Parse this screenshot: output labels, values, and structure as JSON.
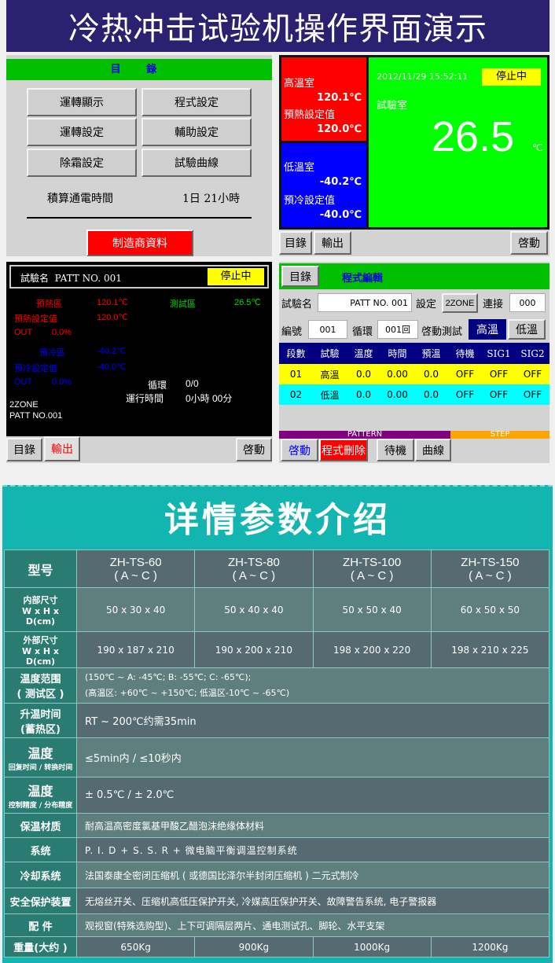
{
  "banner": {
    "title": "冷热冲击试验机操作界面演示"
  },
  "menu_panel": {
    "header": "目 錄",
    "buttons": [
      "運轉顯示",
      "程式設定",
      "運轉設定",
      "輔助設定",
      "除霜設定",
      "試驗曲線"
    ],
    "power_time_label": "積算通電時間",
    "power_time_value": "1日 21小時",
    "manufacturer_button": "制造商資料"
  },
  "monitor_panel": {
    "hot": {
      "label": "高溫室",
      "value": "120.1℃",
      "set_label": "預熱設定值",
      "set_value": "120.0℃"
    },
    "cold": {
      "label": "低溫室",
      "value": "-40.2℃",
      "set_label": "預冷設定值",
      "set_value": "-40.0℃"
    },
    "datetime": "2012/11/29 15:52:11",
    "status": "停止中",
    "test_label": "試驗室",
    "test_value": "26.5",
    "unit": "℃",
    "bottom_buttons": {
      "menu": "目錄",
      "output": "輸出",
      "start": "啓動"
    },
    "colors": {
      "hot": "#ff0000",
      "cold": "#0000ff",
      "test": "#00ff00",
      "status": "#ffff00"
    }
  },
  "run_panel": {
    "test_name_label": "試驗名",
    "test_name": "PATT NO. 001",
    "status": "停止中",
    "preheat_label": "預熱區",
    "preheat_value": "120.1℃",
    "preheat_set_label": "預熱設定值",
    "preheat_set_value": "120.0℃",
    "hot_out_label": "OUT",
    "hot_out_value": "0.0%",
    "test_zone_label": "測試區",
    "test_zone_value": "26.5℃",
    "precool_label": "預冷區",
    "precool_value": "-40.2℃",
    "precool_set_label": "預冷設定值",
    "precool_set_value": "-40.0℃",
    "cold_out_label": "OUT",
    "cold_out_value": "0.0%",
    "cycle_label": "循環",
    "cycle_value": "0/0",
    "runtime_label": "運行時間",
    "runtime_value": "0小時 00分",
    "zone_mode": "2ZONE",
    "pattern_name": "PATT NO.001",
    "bottom_buttons": {
      "menu": "目錄",
      "output": "輸出",
      "start": "啓動"
    }
  },
  "program_panel": {
    "menu_button": "目錄",
    "title": "程式編輯",
    "test_name_label": "試驗名",
    "test_name_value": "PATT NO. 001",
    "setting_label": "設定",
    "setting_value": "2ZONE",
    "link_label": "連接",
    "link_value": "000",
    "number_label": "編號",
    "number_value": "001",
    "cycle_label": "循環",
    "cycle_value": "001回",
    "start_test_label": "啓動測試",
    "high_temp_button": "高溫",
    "low_temp_button": "低溫",
    "table": {
      "headers": [
        "段數",
        "試驗",
        "溫度",
        "時間",
        "預溫",
        "待機",
        "SIG1",
        "SIG2"
      ],
      "rows": [
        [
          "01",
          "高溫",
          "0.0",
          "0.00",
          "0.0",
          "OFF",
          "OFF",
          "OFF"
        ],
        [
          "02",
          "低溫",
          "0.0",
          "0.00",
          "0.0",
          "OFF",
          "OFF",
          "OFF"
        ]
      ]
    },
    "pattern_bar": "PATTERN",
    "step_bar": "STEP",
    "bottom_buttons": {
      "start": "啓動",
      "delete": "程式刪除",
      "standby": "待機",
      "curve": "曲線"
    }
  },
  "spec": {
    "heading": "详情参数介绍",
    "model_label": "型号",
    "models": [
      {
        "name": "ZH-TS-60",
        "variant": "( A ~ C )"
      },
      {
        "name": "ZH-TS-80",
        "variant": "( A ~ C )"
      },
      {
        "name": "ZH-TS-100",
        "variant": "( A ~ C )"
      },
      {
        "name": "ZH-TS-150",
        "variant": "( A ~ C )"
      }
    ],
    "inner_label": "内部尺寸",
    "inner_unit": "W x H x D(cm)",
    "inner": [
      "50 x 30 x 40",
      "50 x 40 x 40",
      "50 x 50 x 40",
      "60 x 50 x 50"
    ],
    "outer_label": "外部尺寸",
    "outer_unit": "W x H x D(cm)",
    "outer": [
      "190 x 187 x 210",
      "190 x 200 x 210",
      "198 x 200 x 220",
      "198 x 210 x 225"
    ],
    "temp_range_label": "温度范围",
    "temp_range_sub": "( 测试区 )",
    "temp_range_line1": "(150℃ ~ A: -45℃; B: -55℃; C: -65℃);",
    "temp_range_line2": "(高温区: +60℃ ~ +150℃; 低温区-10℃ ~ -65℃)",
    "heatup_label": "升温时间",
    "heatup_sub": "(蓄热区)",
    "heatup_value": "RT ~ 200℃约需35min",
    "recovery_label": "温度",
    "recovery_sub": "回复时间 / 转换时间",
    "recovery_value": "≤5min内 / ≤10秒内",
    "accuracy_label": "温度",
    "accuracy_sub": "控制精度 / 分布精度",
    "accuracy_value": "± 0.5℃ / ± 2.0℃",
    "insulation_label": "保温材质",
    "insulation_value": "耐高温高密度氯基甲酸乙醋泡沫绝缘体材料",
    "system_label": "系统",
    "system_value": "P. I. D + S. S. R + 微电脑平衡调温控制系统",
    "cooling_label": "冷却系统",
    "cooling_value": "法国泰康全密闭压缩机 ( 或德国比泽尔半封闭压缩机 ) 二元式制冷",
    "safety_label": "安全保护装置",
    "safety_value": "无熔丝开关、压缩机高低压保护开关, 冷媒高压保护开关、故障警告系统, 电子警报器",
    "accessories_label": "配 件",
    "accessories_value": "观视窗(特殊选购型)、上下可调隔层两片、通电测试孔、脚轮、水平支架",
    "weight_label": "重量(大约 )",
    "weights": [
      "650Kg",
      "900Kg",
      "1000Kg",
      "1200Kg"
    ]
  }
}
